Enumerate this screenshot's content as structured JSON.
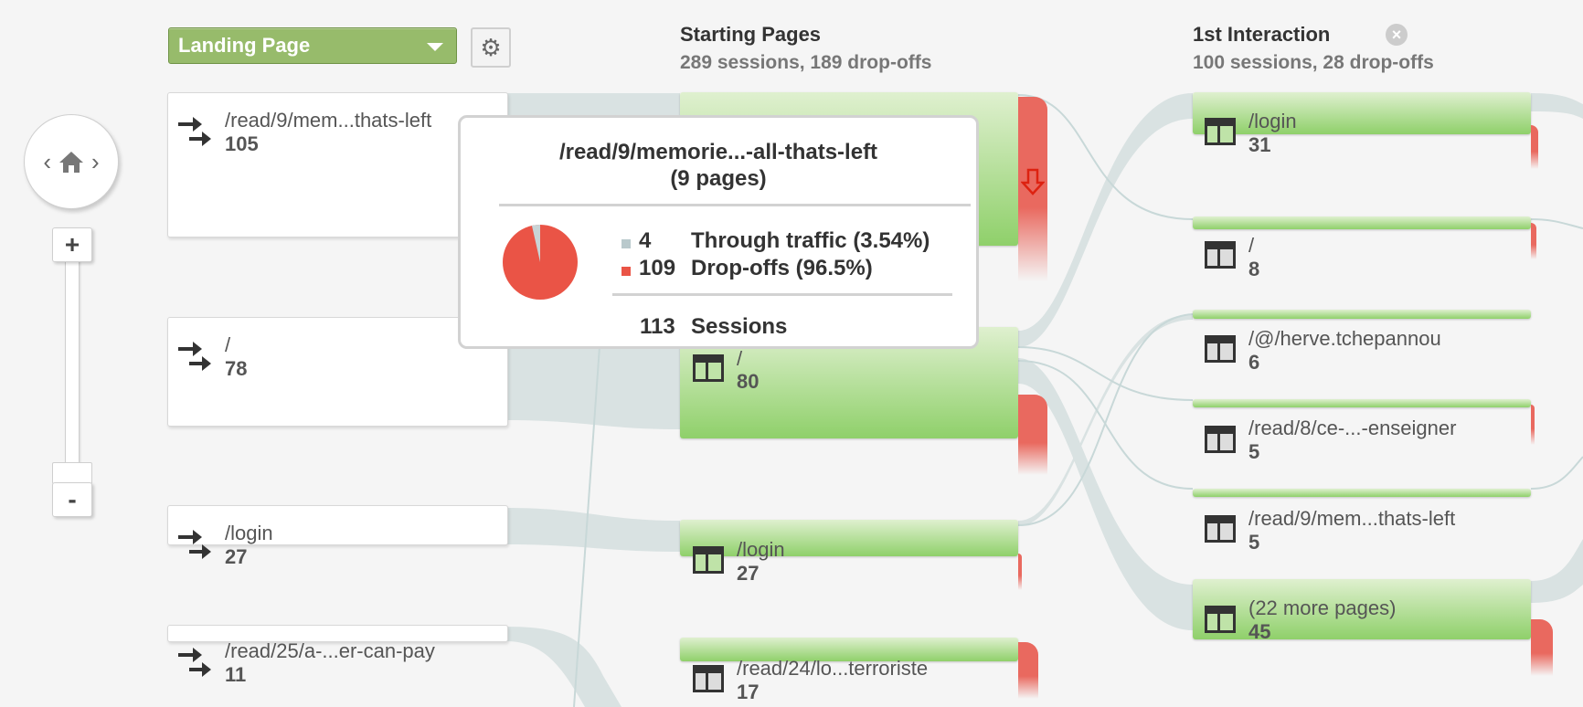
{
  "toolbar": {
    "dropdown_label": "Landing Page",
    "settings_icon": "gear-icon"
  },
  "nav": {
    "prev_icon": "‹",
    "home_icon": "home-icon",
    "next_icon": "›",
    "zoom_in": "+",
    "zoom_out": "-"
  },
  "columns": {
    "starting": {
      "title": "Starting Pages",
      "subtitle": "289 sessions, 189 drop-offs"
    },
    "first": {
      "title": "1st Interaction",
      "subtitle": "100 sessions, 28 drop-offs",
      "close_icon": "close-icon"
    }
  },
  "landing": [
    {
      "label": "/read/9/mem...thats-left",
      "count": "105"
    },
    {
      "label": "/",
      "count": "78"
    },
    {
      "label": "/login",
      "count": "27"
    },
    {
      "label": "/read/25/a-...er-can-pay",
      "count": "11"
    }
  ],
  "starting_nodes": [
    {
      "label": "/",
      "count": "80"
    },
    {
      "label": "/login",
      "count": "27"
    },
    {
      "label": "/read/24/lo...terroriste",
      "count": "17"
    }
  ],
  "first_nodes": [
    {
      "label": "/login",
      "count": "31"
    },
    {
      "label": "/",
      "count": "8"
    },
    {
      "label": "/@/herve.tchepannou",
      "count": "6"
    },
    {
      "label": "/read/8/ce-...-enseigner",
      "count": "5"
    },
    {
      "label": "/read/9/mem...thats-left",
      "count": "5"
    },
    {
      "label": "(22 more pages)",
      "count": "45"
    }
  ],
  "tooltip": {
    "title": "/read/9/memorie...-all-thats-left",
    "subtitle": "(9 pages)",
    "through_count": "4",
    "through_label": "Through traffic (3.54%)",
    "drop_count": "109",
    "drop_label": "Drop-offs (96.5%)",
    "total_count": "113",
    "total_label": "Sessions",
    "through_fraction": 0.0354,
    "drop_fraction": 0.965
  },
  "colors": {
    "node_green": "#8fd06a",
    "drop_red": "#e9695f",
    "flow": "#d6e2e2",
    "dropdown": "#97bb6b"
  }
}
